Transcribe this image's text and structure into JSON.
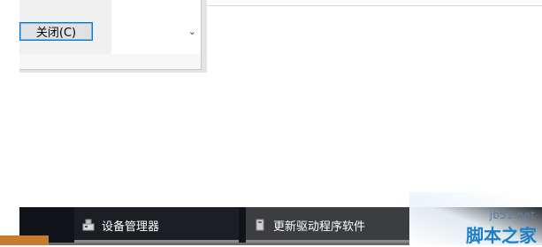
{
  "dialog": {
    "close_button_label": "关闭(C)",
    "scroll_down_icon": "chevron-down-icon"
  },
  "taskbar": {
    "items": [
      {
        "label": "设备管理器",
        "icon": "device-manager-icon"
      },
      {
        "label": "更新驱动程序软件",
        "icon": "driver-update-icon"
      }
    ]
  },
  "watermark": {
    "url": "jb51.net",
    "name": "脚本之家"
  },
  "colors": {
    "taskbar_bg": "#101418",
    "active_task_bg": "#3b3d40",
    "button_border": "#0078d7",
    "watermark_blue": "#1e7fc5"
  }
}
